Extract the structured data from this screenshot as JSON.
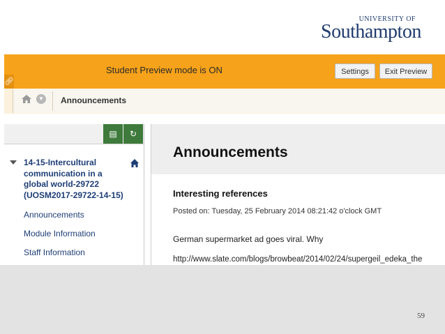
{
  "logo": {
    "top": "UNIVERSITY OF",
    "name": "Southampton"
  },
  "preview_bar": {
    "message": "Student Preview mode is ON",
    "settings_label": "Settings",
    "exit_label": "Exit Preview",
    "tab_icon": "link-icon"
  },
  "breadcrumb": {
    "current": "Announcements",
    "icons": [
      "home-icon",
      "chevron-down-icon"
    ]
  },
  "sidebar": {
    "toolbar_icons": [
      "folder-icon",
      "refresh-icon"
    ],
    "course_title": "14-15-Intercultural communication in a global world-29722 (UOSM2017-29722-14-15)",
    "items": [
      {
        "label": "Announcements"
      },
      {
        "label": "Module Information"
      },
      {
        "label": "Staff Information"
      }
    ]
  },
  "main": {
    "title": "Announcements",
    "post_title": "Interesting references",
    "posted_on": "Posted on: Tuesday, 25 February 2014 08:21:42 o'clock GMT",
    "body": "German supermarket ad goes viral. Why",
    "url": "http://www.slate.com/blogs/browbeat/2014/02/24/supergeil_edeka_the"
  },
  "slide": {
    "page_number": "59"
  }
}
